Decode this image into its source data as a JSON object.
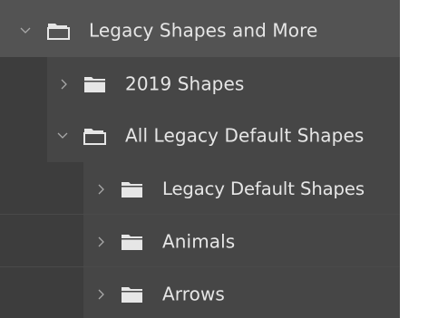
{
  "colors": {
    "panel_bg": "#535353",
    "row_bg": "#464646",
    "indent_bg": "#3d3d3d",
    "text": "#e6e6e6",
    "icon": "#e6e6e6",
    "chevron": "#a8a8a8"
  },
  "tree": {
    "items": [
      {
        "label": "Legacy Shapes and More",
        "expanded": true,
        "icon": "folder-open-icon"
      },
      {
        "label": "2019 Shapes",
        "expanded": false,
        "icon": "folder-icon"
      },
      {
        "label": "All Legacy Default Shapes",
        "expanded": true,
        "icon": "folder-open-icon"
      },
      {
        "label": "Legacy Default Shapes",
        "expanded": false,
        "icon": "folder-icon"
      },
      {
        "label": "Animals",
        "expanded": false,
        "icon": "folder-icon"
      },
      {
        "label": "Arrows",
        "expanded": false,
        "icon": "folder-icon"
      }
    ]
  }
}
